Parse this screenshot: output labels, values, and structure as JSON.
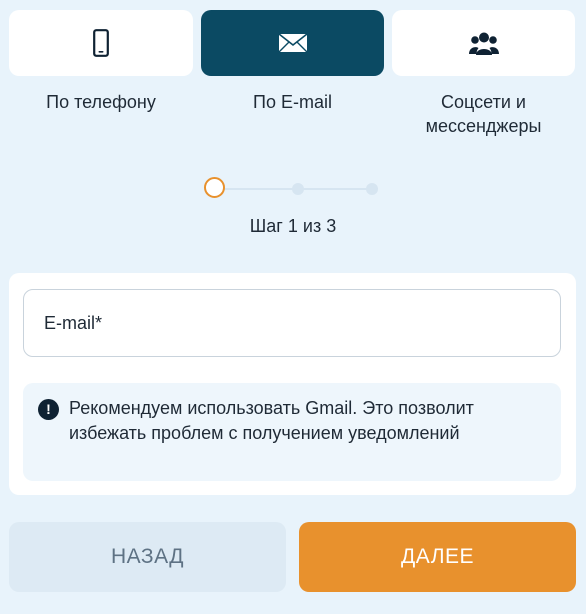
{
  "methods": [
    {
      "label": "По телефону",
      "icon": "phone-icon"
    },
    {
      "label": "По E-mail",
      "icon": "envelope-icon",
      "selected": true
    },
    {
      "label": "Соцсети и мессенджеры",
      "label_line1": "Соцсети и",
      "label_line2": "мессенджеры",
      "icon": "users-icon"
    }
  ],
  "steps": {
    "text": "Шаг 1 из 3",
    "current": 1,
    "total": 3
  },
  "form": {
    "email_placeholder": "E-mail*",
    "email_value": ""
  },
  "notice": {
    "icon": "exclamation-icon",
    "text": "Рекомендуем использовать Gmail. Это позволит избежать проблем с получением уведомлений"
  },
  "buttons": {
    "back_label": "НАЗАД",
    "next_label": "ДАЛЕЕ"
  },
  "colors": {
    "background": "#e8f3fb",
    "selected_card": "#0b4a63",
    "accent": "#e8912d",
    "back_button": "#ddeaf4"
  }
}
